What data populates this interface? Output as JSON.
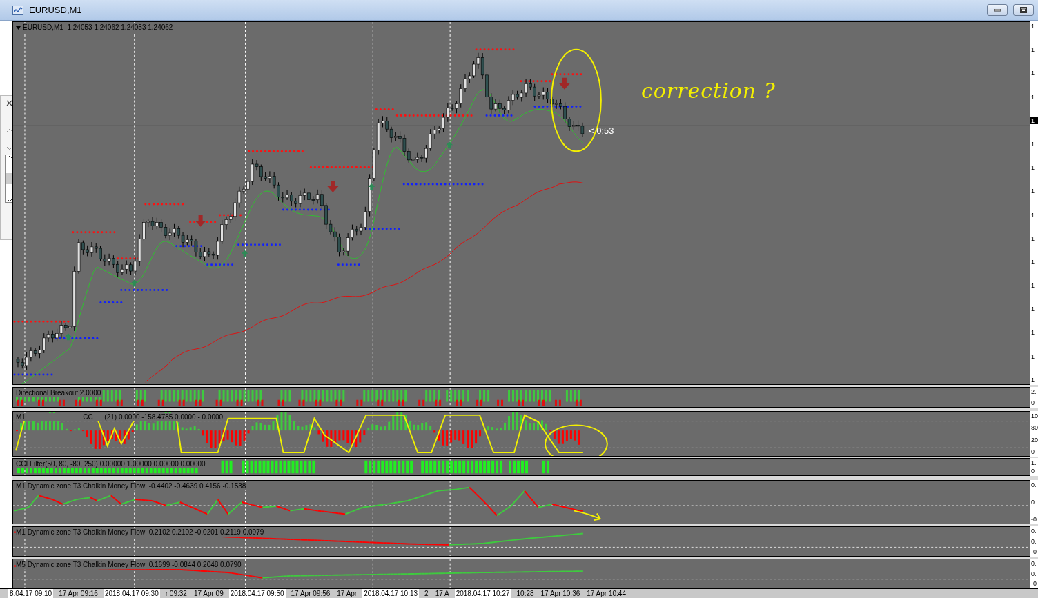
{
  "window": {
    "title": "EURUSD,M1"
  },
  "main_chart": {
    "label": "EURUSD,M1  1.24053 1.24062 1.24053 1.24062",
    "countdown": "< 0:53",
    "note": "correction ?",
    "price_axis": [
      {
        "text": "1",
        "current": false
      },
      {
        "text": "1",
        "current": false
      },
      {
        "text": "1",
        "current": false
      },
      {
        "text": "1",
        "current": false
      },
      {
        "text": "1",
        "current": true
      },
      {
        "text": "1",
        "current": false
      },
      {
        "text": "1",
        "current": false
      },
      {
        "text": "1",
        "current": false
      },
      {
        "text": "1",
        "current": false
      },
      {
        "text": "1",
        "current": false
      },
      {
        "text": "1",
        "current": false
      },
      {
        "text": "1",
        "current": false
      },
      {
        "text": "1",
        "current": false
      },
      {
        "text": "1",
        "current": false
      },
      {
        "text": "1",
        "current": false
      },
      {
        "text": "1",
        "current": false
      }
    ]
  },
  "indicators": [
    {
      "kind": "breakout",
      "label": "Directional Breakout 2.0000",
      "axis": [
        "2.",
        "0"
      ]
    },
    {
      "kind": "stochastic",
      "label": "M1                              CC      (21) 0.0000 -158.4785 0.0000 - 0.0000",
      "axis": [
        "10",
        "80",
        "20",
        "0"
      ]
    },
    {
      "kind": "filter",
      "label": "CCI Filter(50, 80, -80, 250) 0.00000 1.00000 0.00000 0.00000",
      "axis": [
        "1.",
        "0"
      ]
    },
    {
      "kind": "flow",
      "label": "M1 Dynamic zone T3 Chalkin Money Flow  -0.4402 -0.4639 0.4156 -0.1538",
      "axis": [
        "0.",
        "0.",
        "-0"
      ]
    },
    {
      "kind": "flow_slow",
      "label": "M1 Dynamic zone T3 Chalkin Money Flow  0.2102 0.2102 -0.0201 0.2119 0.0979",
      "axis": [
        "0.",
        "0.",
        "-0"
      ]
    },
    {
      "kind": "flow_flat",
      "label": "M5 Dynamic zone T3 Chalkin Money Flow  0.1699 -0.0844 0.2048 0.0790",
      "axis": [
        "0.",
        "0.",
        "-0"
      ]
    }
  ],
  "time_axis": [
    {
      "text": "8.04.17 09:10",
      "selected": true
    },
    {
      "text": "17 Apr 09:16",
      "selected": false
    },
    {
      "text": "2018.04.17 09:30",
      "selected": true
    },
    {
      "text": "r 09:32",
      "selected": false
    },
    {
      "text": "17 Apr 09",
      "selected": false
    },
    {
      "text": "2018.04.17 09:50",
      "selected": true
    },
    {
      "text": "17 Apr 09:56",
      "selected": false
    },
    {
      "text": "17 Apr",
      "selected": false
    },
    {
      "text": "2018.04.17 10:13",
      "selected": true
    },
    {
      "text": "2",
      "selected": false
    },
    {
      "text": "17 A",
      "selected": false
    },
    {
      "text": "2018.04.17 10:27",
      "selected": true
    },
    {
      "text": "10:28",
      "selected": false
    },
    {
      "text": "17 Apr 10:36",
      "selected": false
    },
    {
      "text": "17 Apr 10:44",
      "selected": false
    }
  ]
}
